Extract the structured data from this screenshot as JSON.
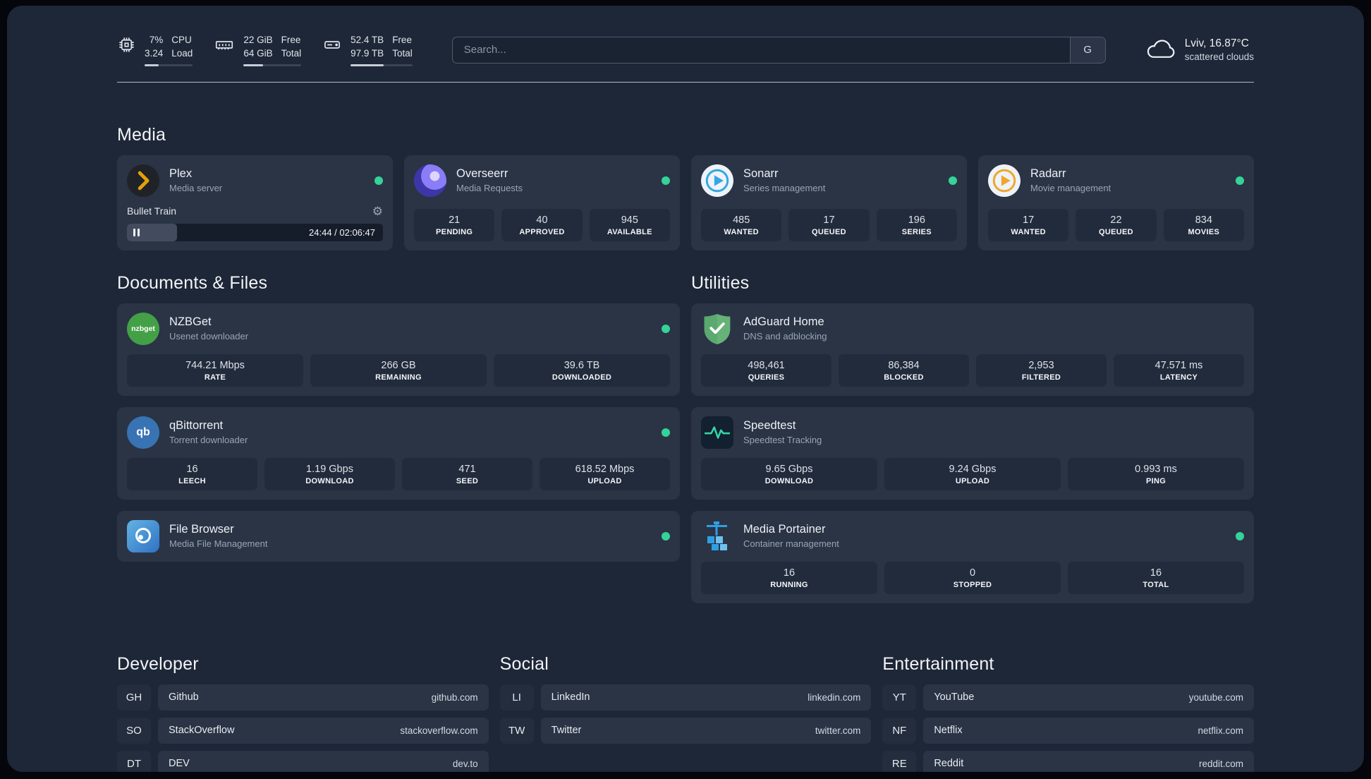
{
  "colors": {
    "status_online": "#34d399",
    "plex_amber": "#e5a00d",
    "accent_green": "#31d8a4"
  },
  "topbar": {
    "cpu": {
      "value_top": "7%",
      "value_bottom": "3.24",
      "label_top": "CPU",
      "label_bottom": "Load",
      "bar_pct": 30
    },
    "memory": {
      "value_top": "22 GiB",
      "value_bottom": "64 GiB",
      "label_top": "Free",
      "label_bottom": "Total",
      "bar_pct": 34
    },
    "disk": {
      "value_top": "52.4 TB",
      "value_bottom": "97.9 TB",
      "label_top": "Free",
      "label_bottom": "Total",
      "bar_pct": 53
    },
    "search": {
      "placeholder": "Search...",
      "button_label": "G"
    },
    "weather": {
      "location": "Lviv, 16.87°C",
      "condition": "scattered clouds"
    }
  },
  "media": {
    "title": "Media",
    "plex": {
      "name": "Plex",
      "subtitle": "Media server",
      "status": "online",
      "now_playing": {
        "title": "Bullet Train",
        "time": "24:44 / 02:06:47",
        "progress_pct": 19.5
      }
    },
    "overseerr": {
      "name": "Overseerr",
      "subtitle": "Media Requests",
      "status": "online",
      "stats": [
        {
          "value": "21",
          "label": "PENDING"
        },
        {
          "value": "40",
          "label": "APPROVED"
        },
        {
          "value": "945",
          "label": "AVAILABLE"
        }
      ]
    },
    "sonarr": {
      "name": "Sonarr",
      "subtitle": "Series management",
      "status": "online",
      "stats": [
        {
          "value": "485",
          "label": "WANTED"
        },
        {
          "value": "17",
          "label": "QUEUED"
        },
        {
          "value": "196",
          "label": "SERIES"
        }
      ]
    },
    "radarr": {
      "name": "Radarr",
      "subtitle": "Movie management",
      "status": "online",
      "stats": [
        {
          "value": "17",
          "label": "WANTED"
        },
        {
          "value": "22",
          "label": "QUEUED"
        },
        {
          "value": "834",
          "label": "MOVIES"
        }
      ]
    }
  },
  "documents": {
    "title": "Documents & Files",
    "nzbget": {
      "name": "NZBGet",
      "subtitle": "Usenet downloader",
      "status": "online",
      "icon_text": "nzbget",
      "stats": [
        {
          "value": "744.21 Mbps",
          "label": "RATE"
        },
        {
          "value": "266 GB",
          "label": "REMAINING"
        },
        {
          "value": "39.6 TB",
          "label": "DOWNLOADED"
        }
      ]
    },
    "qbittorrent": {
      "name": "qBittorrent",
      "subtitle": "Torrent downloader",
      "status": "online",
      "icon_text": "qb",
      "stats": [
        {
          "value": "16",
          "label": "LEECH"
        },
        {
          "value": "1.19 Gbps",
          "label": "DOWNLOAD"
        },
        {
          "value": "471",
          "label": "SEED"
        },
        {
          "value": "618.52 Mbps",
          "label": "UPLOAD"
        }
      ]
    },
    "filebrowser": {
      "name": "File Browser",
      "subtitle": "Media File Management",
      "status": "online"
    }
  },
  "utilities": {
    "title": "Utilities",
    "adguard": {
      "name": "AdGuard Home",
      "subtitle": "DNS and adblocking",
      "stats": [
        {
          "value": "498,461",
          "label": "QUERIES"
        },
        {
          "value": "86,384",
          "label": "BLOCKED"
        },
        {
          "value": "2,953",
          "label": "FILTERED"
        },
        {
          "value": "47.571 ms",
          "label": "LATENCY"
        }
      ]
    },
    "speedtest": {
      "name": "Speedtest",
      "subtitle": "Speedtest Tracking",
      "stats": [
        {
          "value": "9.65 Gbps",
          "label": "DOWNLOAD"
        },
        {
          "value": "9.24 Gbps",
          "label": "UPLOAD"
        },
        {
          "value": "0.993 ms",
          "label": "PING"
        }
      ]
    },
    "portainer": {
      "name": "Media Portainer",
      "subtitle": "Container management",
      "status": "online",
      "stats": [
        {
          "value": "16",
          "label": "RUNNING"
        },
        {
          "value": "0",
          "label": "STOPPED"
        },
        {
          "value": "16",
          "label": "TOTAL"
        }
      ]
    }
  },
  "bookmarks": {
    "developer": {
      "title": "Developer",
      "items": [
        {
          "abbr": "GH",
          "name": "Github",
          "url": "github.com"
        },
        {
          "abbr": "SO",
          "name": "StackOverflow",
          "url": "stackoverflow.com"
        },
        {
          "abbr": "DT",
          "name": "DEV",
          "url": "dev.to"
        }
      ]
    },
    "social": {
      "title": "Social",
      "items": [
        {
          "abbr": "LI",
          "name": "LinkedIn",
          "url": "linkedin.com"
        },
        {
          "abbr": "TW",
          "name": "Twitter",
          "url": "twitter.com"
        }
      ]
    },
    "entertainment": {
      "title": "Entertainment",
      "items": [
        {
          "abbr": "YT",
          "name": "YouTube",
          "url": "youtube.com"
        },
        {
          "abbr": "NF",
          "name": "Netflix",
          "url": "netflix.com"
        },
        {
          "abbr": "RE",
          "name": "Reddit",
          "url": "reddit.com"
        }
      ]
    }
  }
}
